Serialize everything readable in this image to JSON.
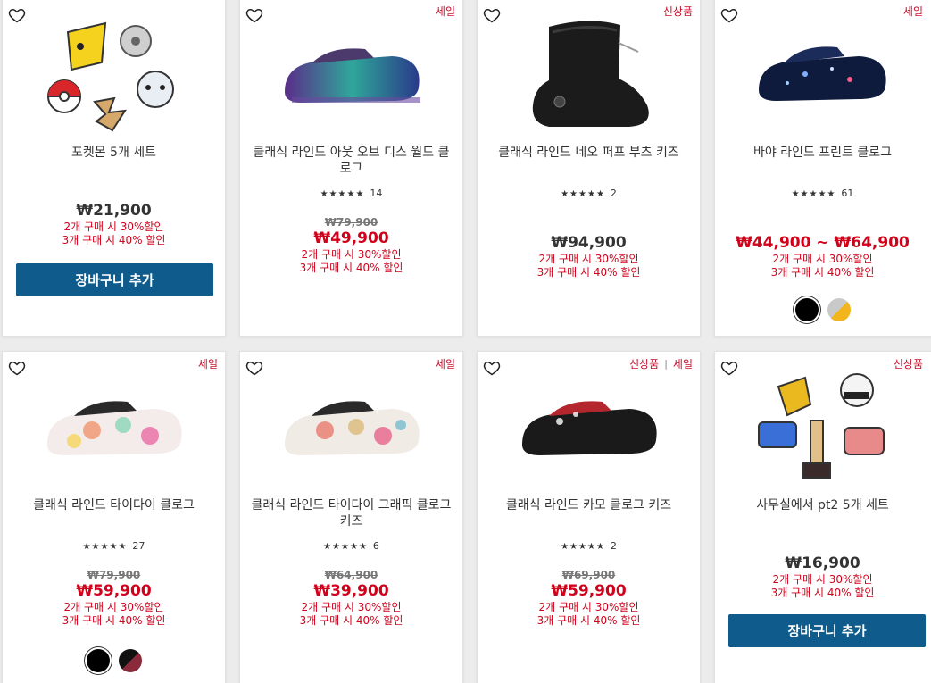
{
  "products": [
    {
      "name": "포켓몬 5개 세트",
      "badges": [],
      "rating": null,
      "old_price": null,
      "price": "₩21,900",
      "promo1": "2개 구매 시 30%할인",
      "promo2": "3개 구매 시 40% 할인",
      "cart_label": "장바구니 추가",
      "swatches": []
    },
    {
      "name": "클래식 라인드 아웃 오브 디스 월드 클로그",
      "badges": [
        "세일"
      ],
      "rating": {
        "stars": "★★★★★",
        "count": "14"
      },
      "old_price": "₩79,900",
      "price": "₩49,900",
      "promo1": "2개 구매 시 30%할인",
      "promo2": "3개 구매 시 40% 할인",
      "swatches": []
    },
    {
      "name": "클래식 라인드 네오 퍼프 부츠 키즈",
      "badges": [
        "신상품"
      ],
      "rating": {
        "stars": "★★★★★",
        "count": "2"
      },
      "old_price": null,
      "price": "₩94,900",
      "promo1": "2개 구매 시 30%할인",
      "promo2": "3개 구매 시 40% 할인",
      "swatches": []
    },
    {
      "name": "바야 라인드 프린트 클로그",
      "badges": [
        "세일"
      ],
      "rating": {
        "stars": "★★★★★",
        "count": "61"
      },
      "old_price": null,
      "price": "₩44,900 ~ ₩64,900",
      "promo1": "2개 구매 시 30%할인",
      "promo2": "3개 구매 시 40% 할인",
      "swatches": [
        "#000000",
        "#c9c9c9"
      ]
    },
    {
      "name": "클래식 라인드 타이다이 클로그",
      "badges": [
        "세일"
      ],
      "rating": {
        "stars": "★★★★★",
        "count": "27"
      },
      "old_price": "₩79,900",
      "price": "₩59,900",
      "promo1": "2개 구매 시 30%할인",
      "promo2": "3개 구매 시 40% 할인",
      "swatches": [
        "#000000",
        "#8a2a3a"
      ]
    },
    {
      "name": "클래식 라인드 타이다이 그래픽 클로그 키즈",
      "badges": [
        "세일"
      ],
      "rating": {
        "stars": "★★★★★",
        "count": "6"
      },
      "old_price": "₩64,900",
      "price": "₩39,900",
      "promo1": "2개 구매 시 30%할인",
      "promo2": "3개 구매 시 40% 할인",
      "swatches": []
    },
    {
      "name": "클래식 라인드 카모 클로그 키즈",
      "badges": [
        "신상품",
        "세일"
      ],
      "rating": {
        "stars": "★★★★★",
        "count": "2"
      },
      "old_price": "₩69,900",
      "price": "₩59,900",
      "promo1": "2개 구매 시 30%할인",
      "promo2": "3개 구매 시 40% 할인",
      "swatches": []
    },
    {
      "name": "사무실에서 pt2 5개 세트",
      "badges": [
        "신상품"
      ],
      "rating": null,
      "old_price": null,
      "price": "₩16,900",
      "promo1": "2개 구매 시 30%할인",
      "promo2": "3개 구매 시 40% 할인",
      "cart_label": "장바구니 추가",
      "swatches": []
    }
  ],
  "colors": {
    "sale_red": "#d0021b",
    "button_blue": "#0f5c8c"
  },
  "icons": {
    "heart": "heart-outline-icon"
  }
}
